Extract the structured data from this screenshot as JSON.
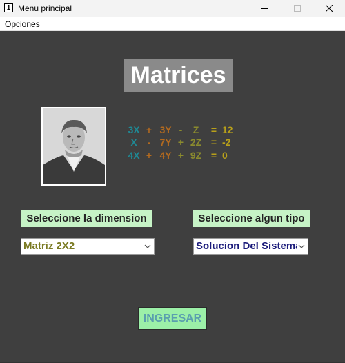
{
  "window": {
    "title": "Menu principal",
    "app_icon_text": "1"
  },
  "menu": {
    "options_label": "Opciones"
  },
  "main": {
    "heading": "Matrices"
  },
  "equations": {
    "colors": {
      "teal": "#1f8a96",
      "orange": "#b36a1f",
      "olive": "#8b8b2e",
      "gold": "#b8a01a"
    },
    "rows": [
      {
        "t1": "3X",
        "op1": "+",
        "t2": "3Y",
        "op2": "-",
        "t3": "Z",
        "eq": "=",
        "rhs": "12"
      },
      {
        "t1": "X",
        "op1": "-",
        "t2": "7Y",
        "op2": "+",
        "t3": "2Z",
        "eq": "=",
        "rhs": "-2"
      },
      {
        "t1": "4X",
        "op1": "+",
        "t2": "4Y",
        "op2": "+",
        "t3": "9Z",
        "eq": "=",
        "rhs": "0"
      }
    ]
  },
  "dimension": {
    "label": "Seleccione la dimension",
    "selected": "Matriz 2X2",
    "selected_color": "#7a7a22"
  },
  "type": {
    "label": "Seleccione algun tipo",
    "selected": "Solucion Del Sistema",
    "selected_color": "#1a1a7a"
  },
  "actions": {
    "submit_label": "INGRESAR"
  },
  "colors": {
    "background": "#3f3f3f",
    "label_bg": "#c6f3c6",
    "button_bg": "#9cf0a8"
  }
}
